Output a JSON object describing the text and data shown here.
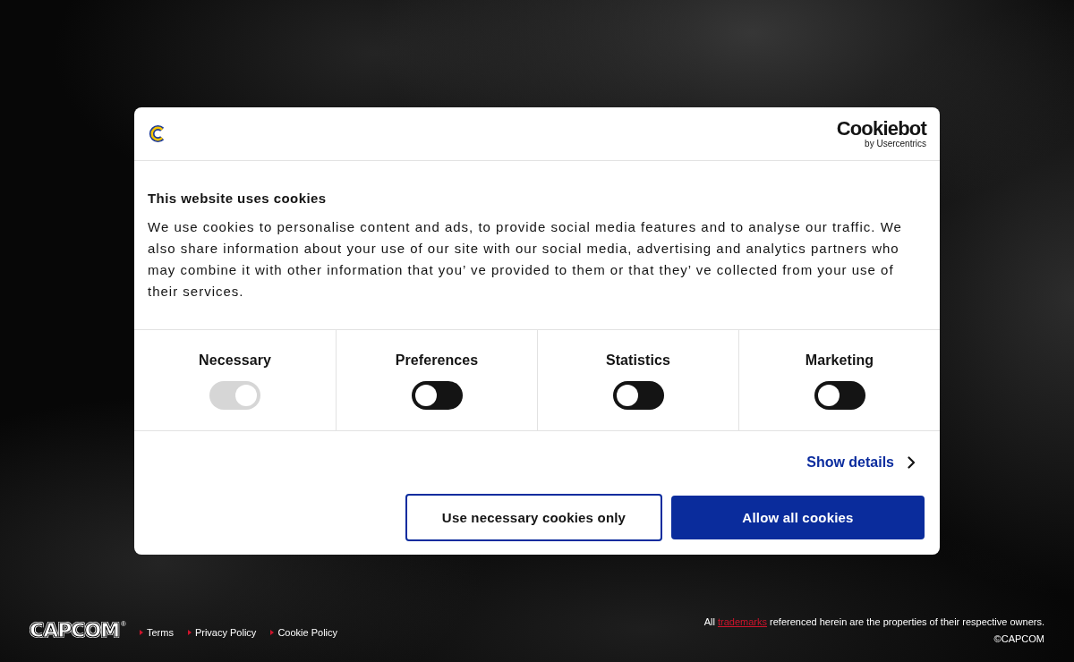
{
  "dialog": {
    "header": {
      "brand_name": "Cookiebot",
      "brand_tagline": "by Usercentrics"
    },
    "title": "This website uses cookies",
    "description": "We use cookies to personalise content and ads, to provide social media features and to analyse our traffic. We also share information about your use of our site with our social media, advertising and analytics partners who may combine it with other information that you’ ve provided to them or that they’ ve collected from your use of their services.",
    "categories": [
      {
        "label": "Necessary",
        "checked": true,
        "disabled": true
      },
      {
        "label": "Preferences",
        "checked": false,
        "disabled": false
      },
      {
        "label": "Statistics",
        "checked": false,
        "disabled": false
      },
      {
        "label": "Marketing",
        "checked": false,
        "disabled": false
      }
    ],
    "details_link": "Show details",
    "buttons": [
      {
        "label": "Use necessary cookies only",
        "kind": "outline"
      },
      {
        "label": "Allow all cookies",
        "kind": "primary"
      }
    ]
  },
  "footer": {
    "logo": "CAPCOM",
    "registered_mark": "®",
    "links": [
      {
        "label": "Terms"
      },
      {
        "label": "Privacy Policy"
      },
      {
        "label": "Cookie Policy"
      }
    ],
    "notice": {
      "before": "All",
      "link": "trademarks",
      "after": "referenced herein are the properties of their respective owners."
    },
    "copyright": "©CAPCOM"
  }
}
